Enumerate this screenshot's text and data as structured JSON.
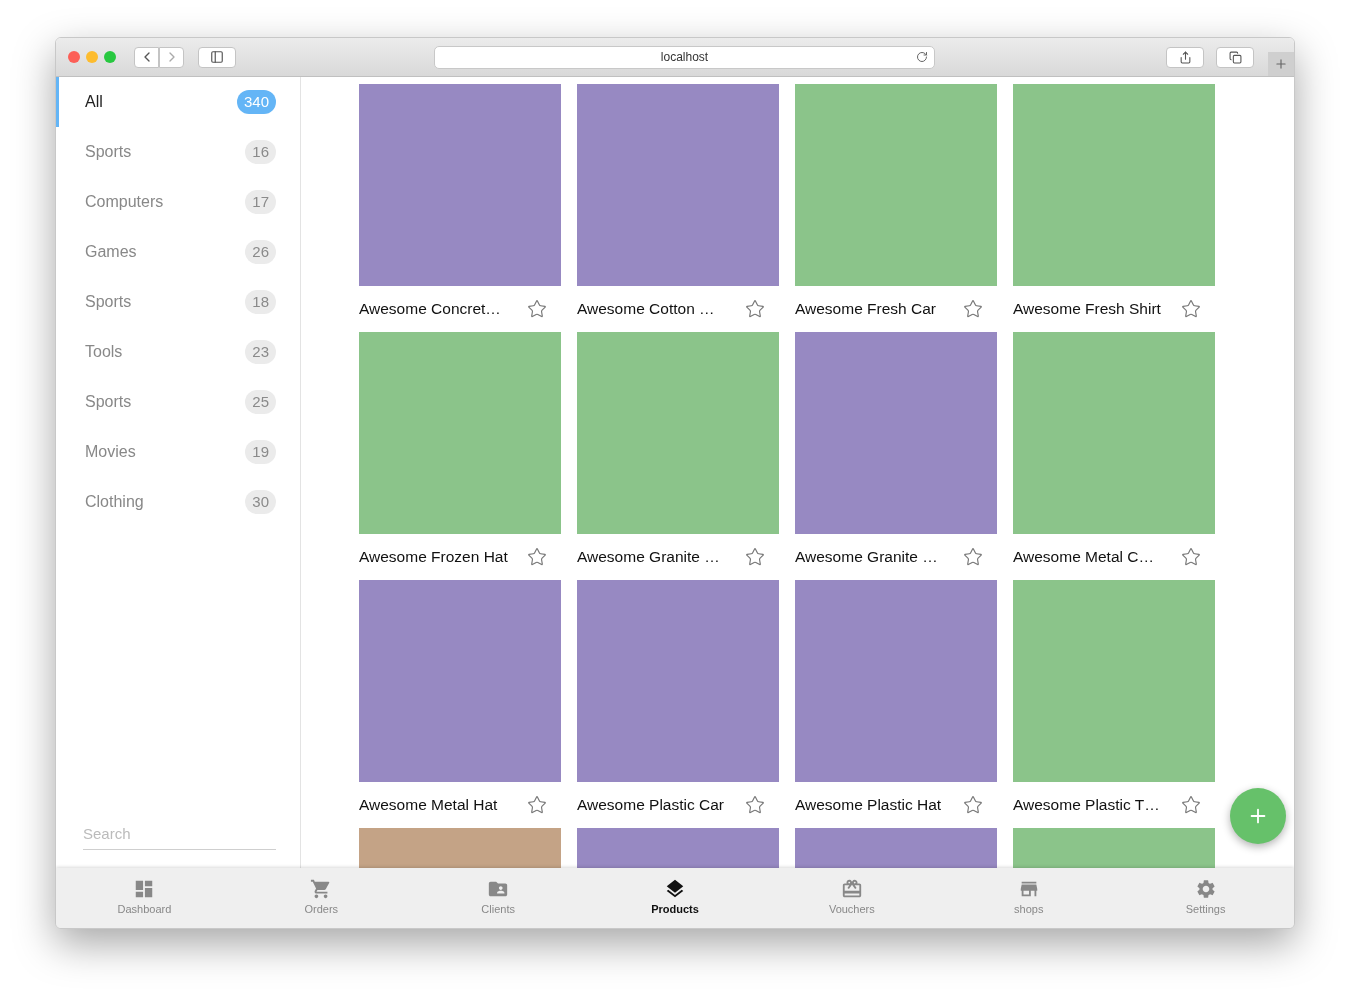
{
  "browser": {
    "url": "localhost"
  },
  "sidebar": {
    "items": [
      {
        "label": "All",
        "count": "340",
        "selected": true
      },
      {
        "label": "Sports",
        "count": "16",
        "selected": false
      },
      {
        "label": "Computers",
        "count": "17",
        "selected": false
      },
      {
        "label": "Games",
        "count": "26",
        "selected": false
      },
      {
        "label": "Sports",
        "count": "18",
        "selected": false
      },
      {
        "label": "Tools",
        "count": "23",
        "selected": false
      },
      {
        "label": "Sports",
        "count": "25",
        "selected": false
      },
      {
        "label": "Movies",
        "count": "19",
        "selected": false
      },
      {
        "label": "Clothing",
        "count": "30",
        "selected": false
      }
    ],
    "search": {
      "placeholder": "Search"
    }
  },
  "products": [
    {
      "name": "Awesome Concret…",
      "color": "#9789c2"
    },
    {
      "name": "Awesome Cotton …",
      "color": "#9789c2"
    },
    {
      "name": "Awesome Fresh Car",
      "color": "#8bc48a"
    },
    {
      "name": "Awesome Fresh Shirt",
      "color": "#8bc48a"
    },
    {
      "name": "Awesome Frozen Hat",
      "color": "#8bc48a"
    },
    {
      "name": "Awesome Granite …",
      "color": "#8bc48a"
    },
    {
      "name": "Awesome Granite …",
      "color": "#9789c2"
    },
    {
      "name": "Awesome Metal C…",
      "color": "#8bc48a"
    },
    {
      "name": "Awesome Metal Hat",
      "color": "#9789c2"
    },
    {
      "name": "Awesome Plastic Car",
      "color": "#9789c2"
    },
    {
      "name": "Awesome Plastic Hat",
      "color": "#9789c2"
    },
    {
      "name": "Awesome Plastic T…",
      "color": "#8bc48a"
    },
    {
      "color": "#c4a386"
    },
    {
      "color": "#9789c2"
    },
    {
      "color": "#9789c2"
    },
    {
      "color": "#8bc48a"
    }
  ],
  "bottom_nav": [
    {
      "label": "Dashboard",
      "selected": false
    },
    {
      "label": "Orders",
      "selected": false
    },
    {
      "label": "Clients",
      "selected": false
    },
    {
      "label": "Products",
      "selected": true
    },
    {
      "label": "Vouchers",
      "selected": false
    },
    {
      "label": "shops",
      "selected": false
    },
    {
      "label": "Settings",
      "selected": false
    }
  ]
}
